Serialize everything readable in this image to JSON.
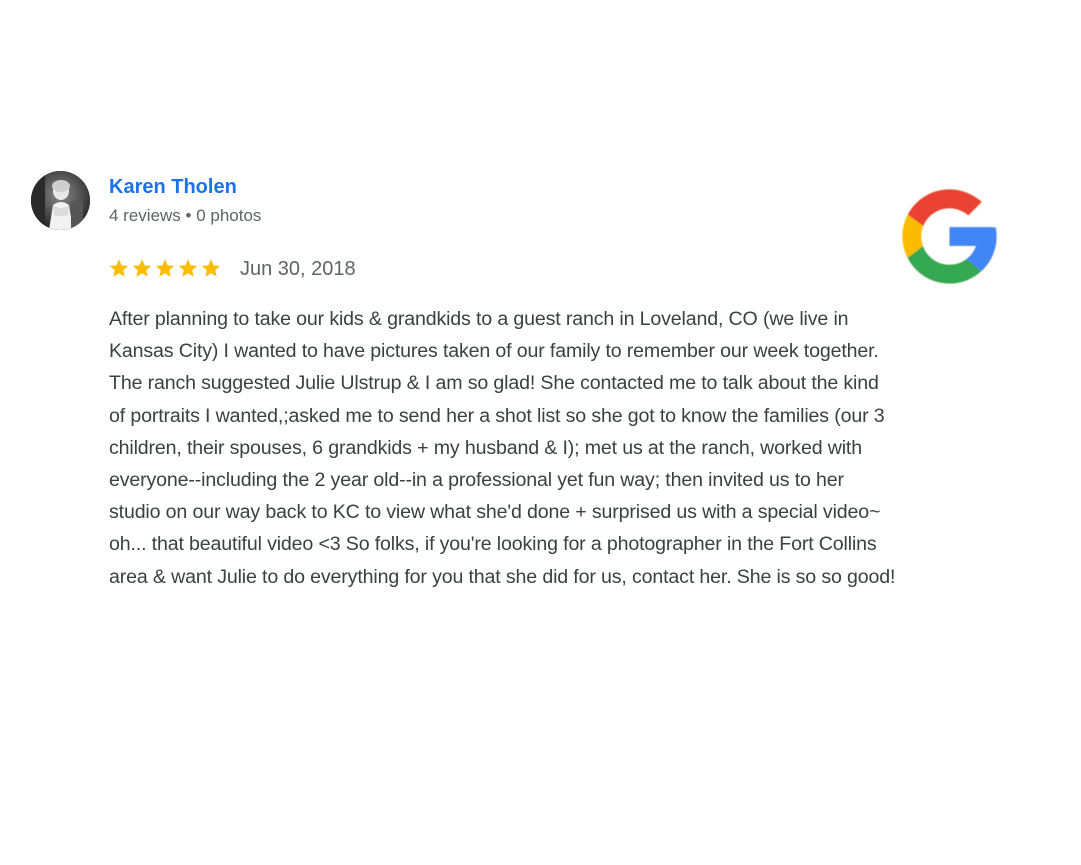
{
  "review": {
    "author_name": "Karen Tholen",
    "author_meta": "4 reviews • 0 photos",
    "rating": 5,
    "date": "Jun 30, 2018",
    "text_lines": [
      "After planning to take our kids & grandkids to a guest ranch in Loveland, CO (we live in",
      "Kansas City) I wanted to have pictures taken of our family to remember our week together.",
      "The ranch suggested Julie Ulstrup & I am so glad! She contacted me to talk about the kind",
      "of portraits I wanted,;asked me to send her a shot list so she got to know the families (our 3",
      "children, their spouses, 6 grandkids + my husband & I); met us at the ranch, worked with",
      "everyone--including the 2 year old--in a professional yet fun way; then invited us to her",
      "studio on our way back to KC to view what she'd done + surprised us with a special video~",
      "oh... that beautiful video <3 So folks, if you're looking for a photographer in the Fort Collins",
      "area & want Julie to do everything for you that she did for us, contact her. She is so so good!"
    ]
  },
  "icons": {
    "avatar": "profile-photo",
    "star": "star-icon",
    "logo": "google-g-logo"
  },
  "colors": {
    "author": "#1a73e8",
    "star": "#fbbc04",
    "meta": "#5f6368",
    "text": "#3c4043",
    "google_red": "#ea4335",
    "google_yellow": "#fbbc05",
    "google_green": "#34a853",
    "google_blue": "#4285f4"
  }
}
